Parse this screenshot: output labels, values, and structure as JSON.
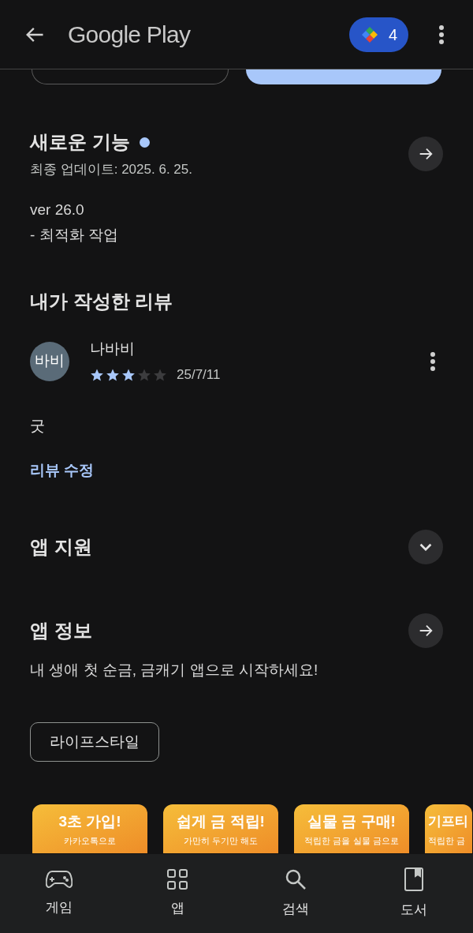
{
  "header": {
    "title": "Google Play",
    "badge": "4"
  },
  "whats_new": {
    "title": "새로운 기능",
    "updated": "최종 업데이트: 2025. 6. 25.",
    "notes": [
      "ver 26.0",
      "- 최적화 작업"
    ]
  },
  "my_review": {
    "title": "내가 작성한 리뷰",
    "avatar": "바비",
    "name": "나바비",
    "stars": 3,
    "date": "25/7/11",
    "text": "굿",
    "edit_link": "리뷰 수정"
  },
  "app_support": {
    "title": "앱 지원",
    "expanded": false
  },
  "app_info": {
    "title": "앱 정보",
    "description": "내 생애 첫 순금, 금캐기 앱으로 시작하세요!",
    "tag": "라이프스타일"
  },
  "screenshots": [
    {
      "title": "3초 가입!",
      "subtitle": "카카오톡으로"
    },
    {
      "title": "쉽게 금 적립!",
      "subtitle": "가만히 두기만 해도"
    },
    {
      "title": "실물 금 구매!",
      "subtitle": "적립한 금을 실물 금으로"
    },
    {
      "title": "기프티",
      "subtitle": "적립한 금"
    }
  ],
  "bottom_nav": [
    {
      "label": "게임",
      "kind": "games"
    },
    {
      "label": "앱",
      "kind": "apps"
    },
    {
      "label": "검색",
      "kind": "search"
    },
    {
      "label": "도서",
      "kind": "books"
    }
  ]
}
